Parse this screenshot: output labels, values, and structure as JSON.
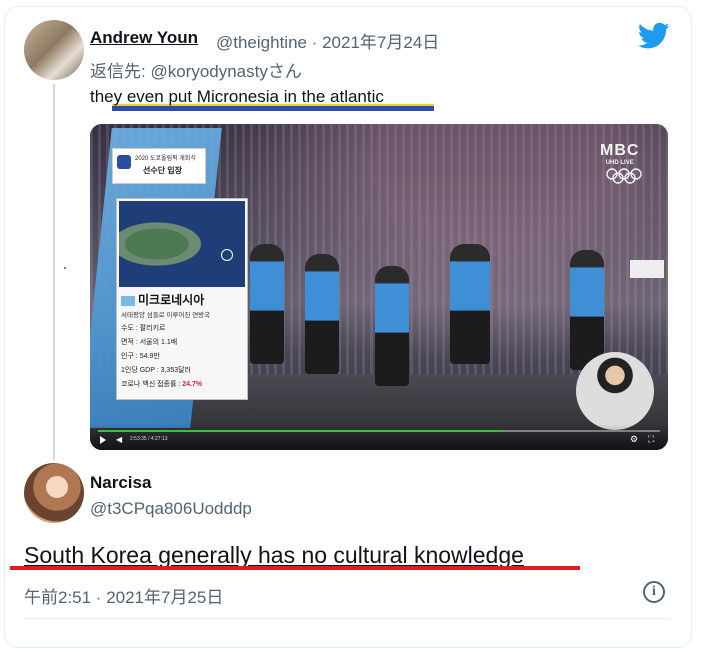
{
  "tweet1": {
    "author_name": "Andrew Youn",
    "handle_date": "@theightine · 2021年7月24日",
    "reply_to": "返信先: @koryodynastyさん",
    "text": "they even put Micronesia in the atlantic"
  },
  "media": {
    "broadcast_logo": "MBC",
    "broadcast_sub": "UHD LIVE",
    "overlay_line1": "2020 도쿄올림픽 개회식",
    "overlay_line2": "선수단 입장",
    "country_name": "미크로네시아",
    "country_subtitle": "서태평양 섬들로 이루어진 연방국",
    "facts": [
      {
        "label": "수도 : 팔리키르",
        "value": ""
      },
      {
        "label": "면적 : 서울의 1.1배",
        "value": ""
      },
      {
        "label": "인구 : 54.9만",
        "value": ""
      },
      {
        "label": "1인당 GDP : 3,353달러",
        "value": ""
      },
      {
        "label": "코로나 백신 접종률 : ",
        "value": "24.7%"
      }
    ],
    "player_time": "2:53:35 / 4:27:13",
    "progress_fraction": 0.72
  },
  "tweet2": {
    "author_name": "Narcisa",
    "handle": "@t3CPqa806Uodddp",
    "text": "South Korea generally has no cultural knowledge",
    "timestamp": "午前2:51 · 2021年7月25日"
  },
  "colors": {
    "twitter_blue": "#1d9bf0",
    "highlight_yellow": "#f0d32a",
    "highlight_blue": "#2f4aa8",
    "highlight_red": "#e01b24",
    "secondary_text": "#536471"
  }
}
